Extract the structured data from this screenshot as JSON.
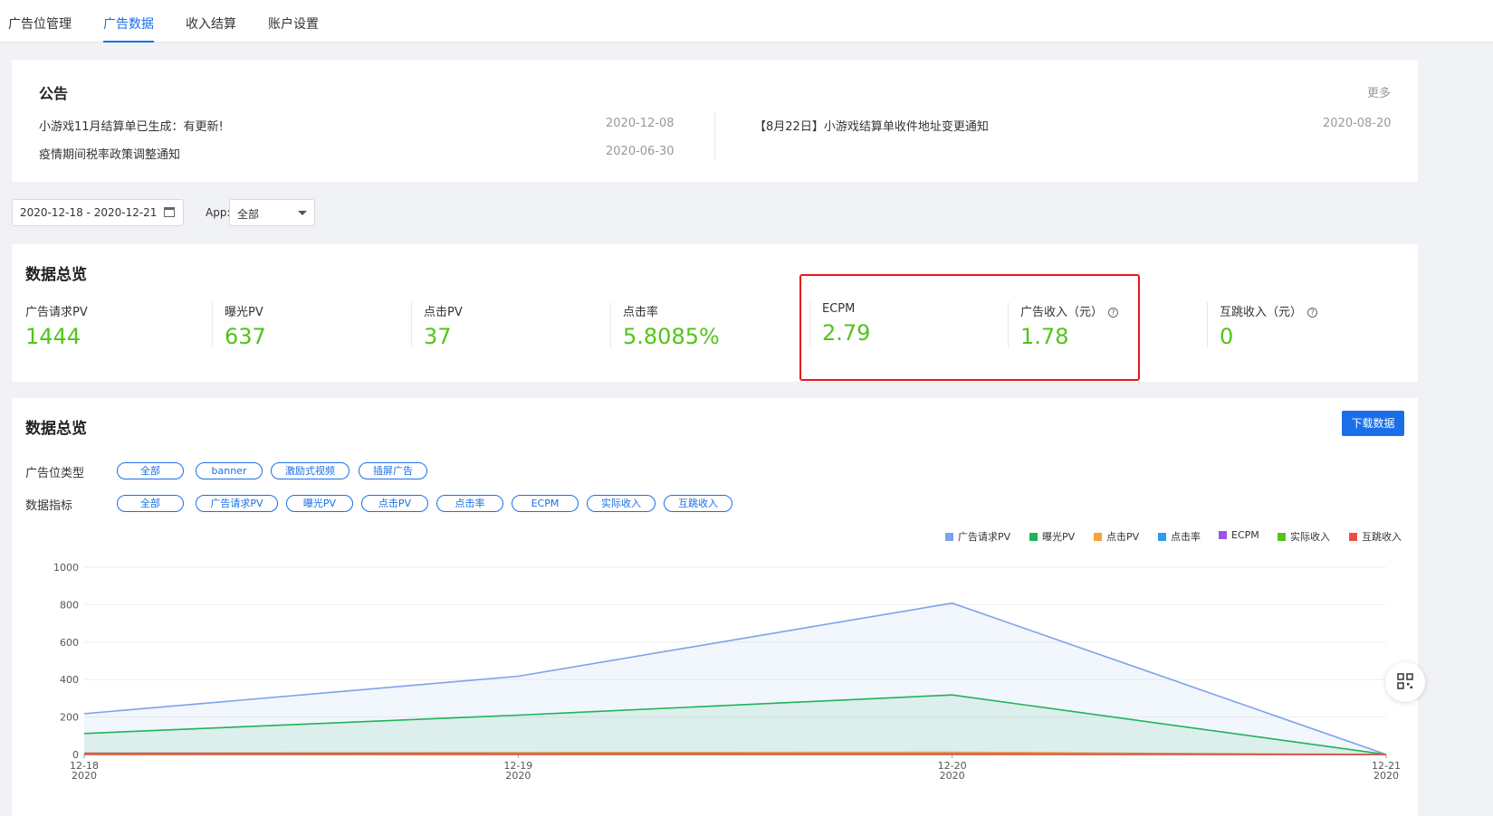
{
  "nav": {
    "tabs": [
      "广告位管理",
      "广告数据",
      "收入结算",
      "账户设置"
    ]
  },
  "notice": {
    "title": "公告",
    "more": "更多",
    "items": [
      {
        "text": "小游戏11月结算单已生成：有更新!",
        "date": "2020-12-08"
      },
      {
        "text": "疫情期间税率政策调整通知",
        "date": "2020-06-30"
      },
      {
        "text": "【8月22日】小游戏结算单收件地址变更通知",
        "date": "2020-08-20"
      }
    ]
  },
  "filters": {
    "date_range": "2020-12-18 - 2020-12-21",
    "app_label": "App:",
    "app_value": "全部"
  },
  "overview": {
    "title": "数据总览",
    "metrics": [
      {
        "label": "广告请求PV",
        "value": "1444"
      },
      {
        "label": "曝光PV",
        "value": "637"
      },
      {
        "label": "点击PV",
        "value": "37"
      },
      {
        "label": "点击率",
        "value": "5.8085%"
      },
      {
        "label": "ECPM",
        "value": "2.79"
      },
      {
        "label": "广告收入（元）",
        "value": "1.78"
      },
      {
        "label": "互跳收入（元）",
        "value": "0"
      }
    ]
  },
  "chart_section": {
    "title": "数据总览",
    "download": "下载数据",
    "ad_type_label": "广告位类型",
    "ad_types": [
      "全部",
      "banner",
      "激励式视频",
      "插屏广告"
    ],
    "metric_label": "数据指标",
    "metric_filters": [
      "全部",
      "广告请求PV",
      "曝光PV",
      "点击PV",
      "点击率",
      "ECPM",
      "实际收入",
      "互跳收入"
    ]
  },
  "chart_data": {
    "type": "area",
    "x": [
      "12-18",
      "12-19",
      "12-20",
      "12-21"
    ],
    "x_sublabel": "2020",
    "ylim": [
      0,
      1000
    ],
    "yticks": [
      0,
      200,
      400,
      600,
      800,
      1000
    ],
    "grid": true,
    "legend_position": "top-right",
    "series": [
      {
        "name": "广告请求PV",
        "values": [
          218,
          418,
          808,
          0
        ],
        "color": "#7ca3ea"
      },
      {
        "name": "曝光PV",
        "values": [
          112,
          210,
          318,
          0
        ],
        "color": "#1fb35a"
      },
      {
        "name": "点击PV",
        "values": [
          8,
          10,
          12,
          0
        ],
        "color": "#f7a33c"
      },
      {
        "name": "点击率",
        "values": [
          6,
          5,
          4,
          0
        ],
        "color": "#2b9cf0"
      },
      {
        "name": "ECPM",
        "values": [
          5,
          3,
          4,
          0
        ],
        "color": "#9b55e6"
      },
      {
        "name": "实际收入",
        "values": [
          1,
          1,
          1,
          0
        ],
        "color": "#52c41a"
      },
      {
        "name": "互跳收入",
        "values": [
          0,
          0,
          0,
          0
        ],
        "color": "#f04b4b"
      }
    ]
  }
}
